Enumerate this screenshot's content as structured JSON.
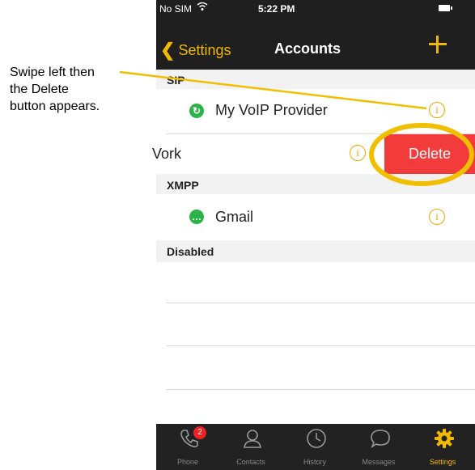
{
  "callout": {
    "line1": "Swipe left then",
    "line2": "the Delete",
    "line3": "button appears."
  },
  "status_bar": {
    "carrier": "No SIM",
    "time": "5:22 PM"
  },
  "nav": {
    "back_label": "Settings",
    "title": "Accounts"
  },
  "sections": {
    "sip": "SIP",
    "xmpp": "XMPP",
    "disabled": "Disabled"
  },
  "accounts": {
    "voip": "My VoIP Provider",
    "work": "Vork",
    "gmail": "Gmail"
  },
  "delete_label": "Delete",
  "tabs": [
    {
      "label": "Phone",
      "icon": "phone-icon",
      "badge": "2"
    },
    {
      "label": "Contacts",
      "icon": "contacts-icon"
    },
    {
      "label": "History",
      "icon": "history-icon"
    },
    {
      "label": "Messages",
      "icon": "messages-icon"
    },
    {
      "label": "Settings",
      "icon": "settings-gear-icon",
      "active": true
    }
  ],
  "colors": {
    "accent": "#f0b800",
    "delete": "#f23c3c",
    "bar": "#1f1f1f"
  }
}
